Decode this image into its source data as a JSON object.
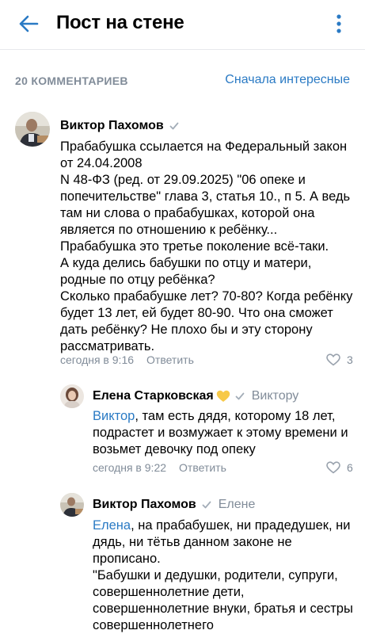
{
  "header": {
    "title": "Пост на стене",
    "back_icon": "arrow-left-icon",
    "more_icon": "more-vertical-icon",
    "accent": "#2a7ac4"
  },
  "comments_bar": {
    "count_label": "20 КОММЕНТАРИЕВ",
    "sort_label": "Сначала интересные"
  },
  "comments": [
    {
      "author": "Виктор Пахомов",
      "text": "Прабабушка ссылается на Федеральный закон от 24.04.2008\nN 48-ФЗ (ред. от 29.09.2025) \"06 опеке и попечительстве\" глава 3, статья 10., п 5. А ведь там ни слова о прабабушках, которой она является по отношению к ребёнку...\nПрабабушка это третье поколение всё-таки.\nА куда делись бабушки по отцу и матери, родные по отцу ребёнка?\nСколько прабабушке лет? 70-80? Когда ребёнку будет 13 лет, ей будет 80-90. Что она сможет дать ребёнку? Не плохо бы и эту сторону рассматривать.",
      "time": "сегодня в 9:16",
      "reply_label": "Ответить",
      "likes": "3"
    },
    {
      "author": "Елена Старковская",
      "reply_to": "Виктору",
      "mention": "Виктор",
      "text": ", там есть дядя, которому 18 лет, подрастет и возмужает к этому времени и возьмет девочку под опеку",
      "time": "сегодня в 9:22",
      "reply_label": "Ответить",
      "likes": "6"
    },
    {
      "author": "Виктор Пахомов",
      "reply_to": "Елене",
      "mention": "Елена",
      "text": ", на прабабушек, ни прадедушек, ни дядь, ни тётьв данном законе не прописано.\n\"Бабушки и дедушки, родители, супруги, совершеннолетние дети, совершеннолетние внуки, братья и сестры совершеннолетнего"
    }
  ]
}
